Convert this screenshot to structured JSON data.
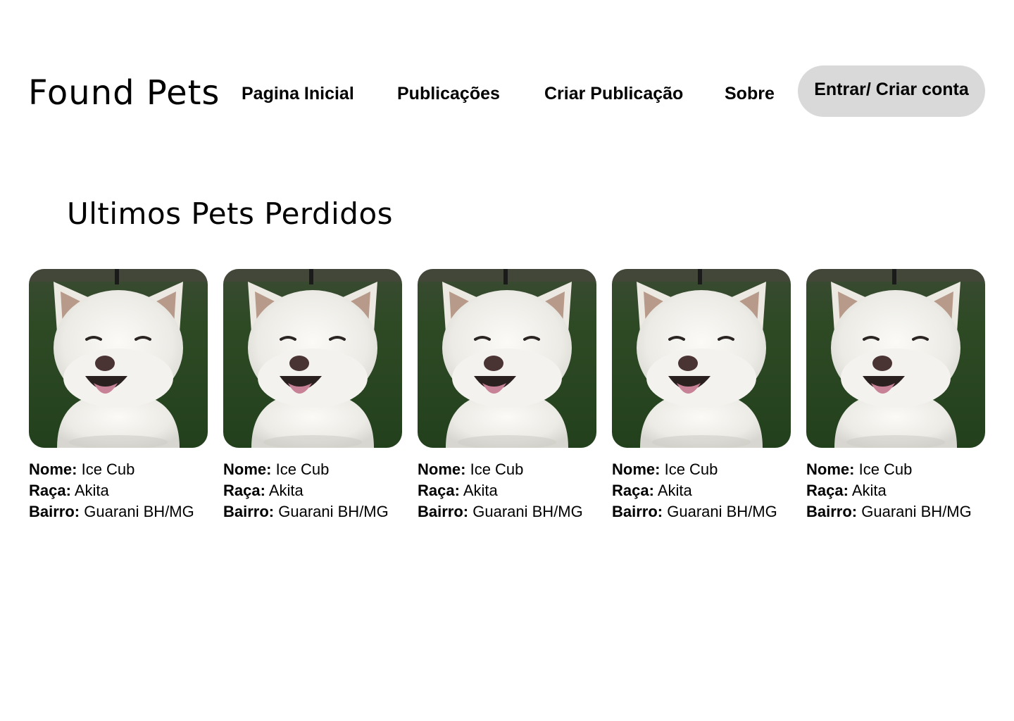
{
  "header": {
    "logo": "Found Pets",
    "nav": {
      "home": "Pagina Inicial",
      "posts": "Publicações",
      "create": "Criar Publicação",
      "about": "Sobre"
    },
    "login_button": "Entrar/ Criar conta"
  },
  "main": {
    "section_title": "Ultimos Pets Perdidos",
    "pets": [
      {
        "name_label": "Nome:",
        "name": "Ice Cub",
        "breed_label": "Raça:",
        "breed": "Akita",
        "district_label": "Bairro:",
        "district": "Guarani BH/MG"
      },
      {
        "name_label": "Nome:",
        "name": "Ice Cub",
        "breed_label": "Raça:",
        "breed": "Akita",
        "district_label": "Bairro:",
        "district": "Guarani BH/MG"
      },
      {
        "name_label": "Nome:",
        "name": "Ice Cub",
        "breed_label": "Raça:",
        "breed": "Akita",
        "district_label": "Bairro:",
        "district": "Guarani BH/MG"
      },
      {
        "name_label": "Nome:",
        "name": "Ice Cub",
        "breed_label": "Raça:",
        "breed": "Akita",
        "district_label": "Bairro:",
        "district": "Guarani BH/MG"
      },
      {
        "name_label": "Nome:",
        "name": "Ice Cub",
        "breed_label": "Raça:",
        "breed": "Akita",
        "district_label": "Bairro:",
        "district": "Guarani BH/MG"
      }
    ]
  },
  "colors": {
    "background": "#ffffff",
    "text": "#000000",
    "button_bg": "#d9d9d9",
    "photo_grass": "#2f4a26",
    "dog_fur": "#f1f0ec"
  },
  "icons": {
    "pet_photo": "white-akita-dog-photo"
  }
}
